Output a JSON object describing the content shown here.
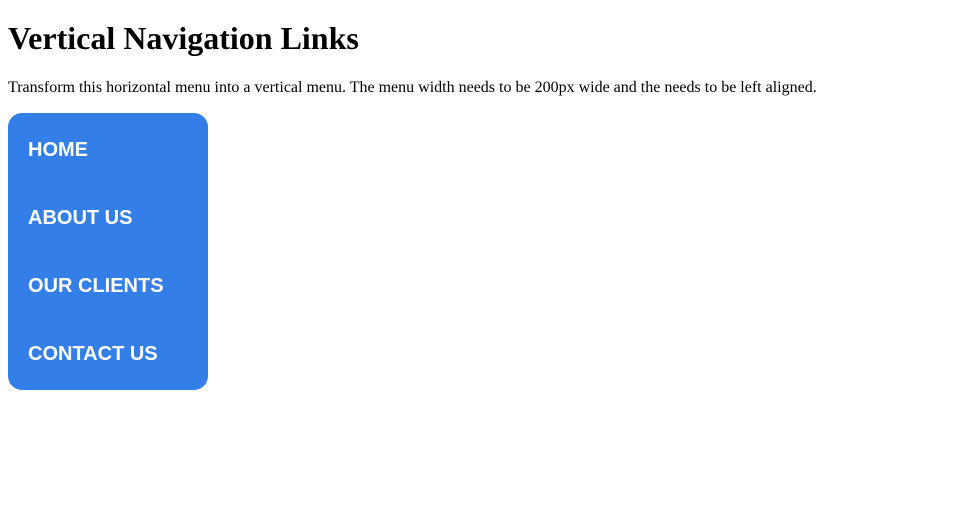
{
  "page": {
    "title": "Vertical Navigation Links",
    "instructions": "Transform this horizontal menu into a vertical menu. The menu width needs to be 200px wide and the needs to be left aligned."
  },
  "nav": {
    "background_color": "#337ee7",
    "text_color": "#ffffff",
    "items": [
      {
        "label": "HOME"
      },
      {
        "label": "ABOUT US"
      },
      {
        "label": "OUR CLIENTS"
      },
      {
        "label": "CONTACT US"
      }
    ]
  }
}
